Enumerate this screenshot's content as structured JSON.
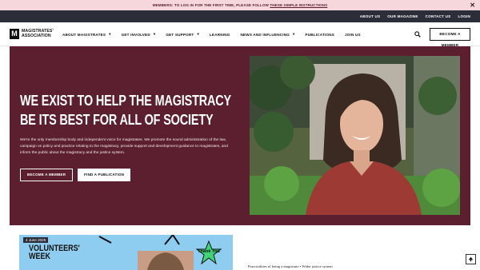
{
  "alert": {
    "text": "MEMBERS: TO LOG IN FOR THE FIRST TIME, PLEASE FOLLOW",
    "link": "THESE SIMPLE INSTRUCTIONS",
    "close_icon": "close-icon"
  },
  "utility_nav": [
    "ABOUT US",
    "OUR MAGAZINE",
    "CONTACT US",
    "LOGIN"
  ],
  "logo": {
    "mark": "M",
    "line1": "MAGISTRATES'",
    "line2": "ASSOCIATION"
  },
  "main_nav": [
    {
      "label": "ABOUT MAGISTRATES",
      "dropdown": true
    },
    {
      "label": "GET INVOLVED",
      "dropdown": true
    },
    {
      "label": "GET SUPPORT",
      "dropdown": true
    },
    {
      "label": "LEARNING",
      "dropdown": false
    },
    {
      "label": "NEWS AND INFLUENCING",
      "dropdown": true
    },
    {
      "label": "PUBLICATIONS",
      "dropdown": false
    },
    {
      "label": "JOIN US",
      "dropdown": false
    }
  ],
  "header_cta": "BECOME A MEMBER",
  "hero": {
    "title_line1": "WE EXIST TO HELP THE MAGISTRACY",
    "title_line2": "BE ITS BEST FOR ALL OF SOCIETY",
    "description": "We're the only membership body and independent voice for magistrates. We promote the sound administration of the law, campaign on policy and practice relating to the magistracy, provide support and development guidance to magistrates, and inform the public about the magistracy and the justice system.",
    "button_primary": "BECOME A MEMBER",
    "button_secondary": "FIND A PUBLICATION"
  },
  "feature_card": {
    "date": "4 June 2025",
    "title_line1": "VOLUNTEERS'",
    "title_line2": "WEEK",
    "sticker": "Thank You"
  },
  "breadcrumb": "Practicalities of being a magistrate  •  Wider justice system",
  "colors": {
    "brand": "#5b1f2f",
    "alert_bg": "#f6d7dc",
    "util_bg": "#2b2d38",
    "card_bg": "#8ecdf0"
  }
}
